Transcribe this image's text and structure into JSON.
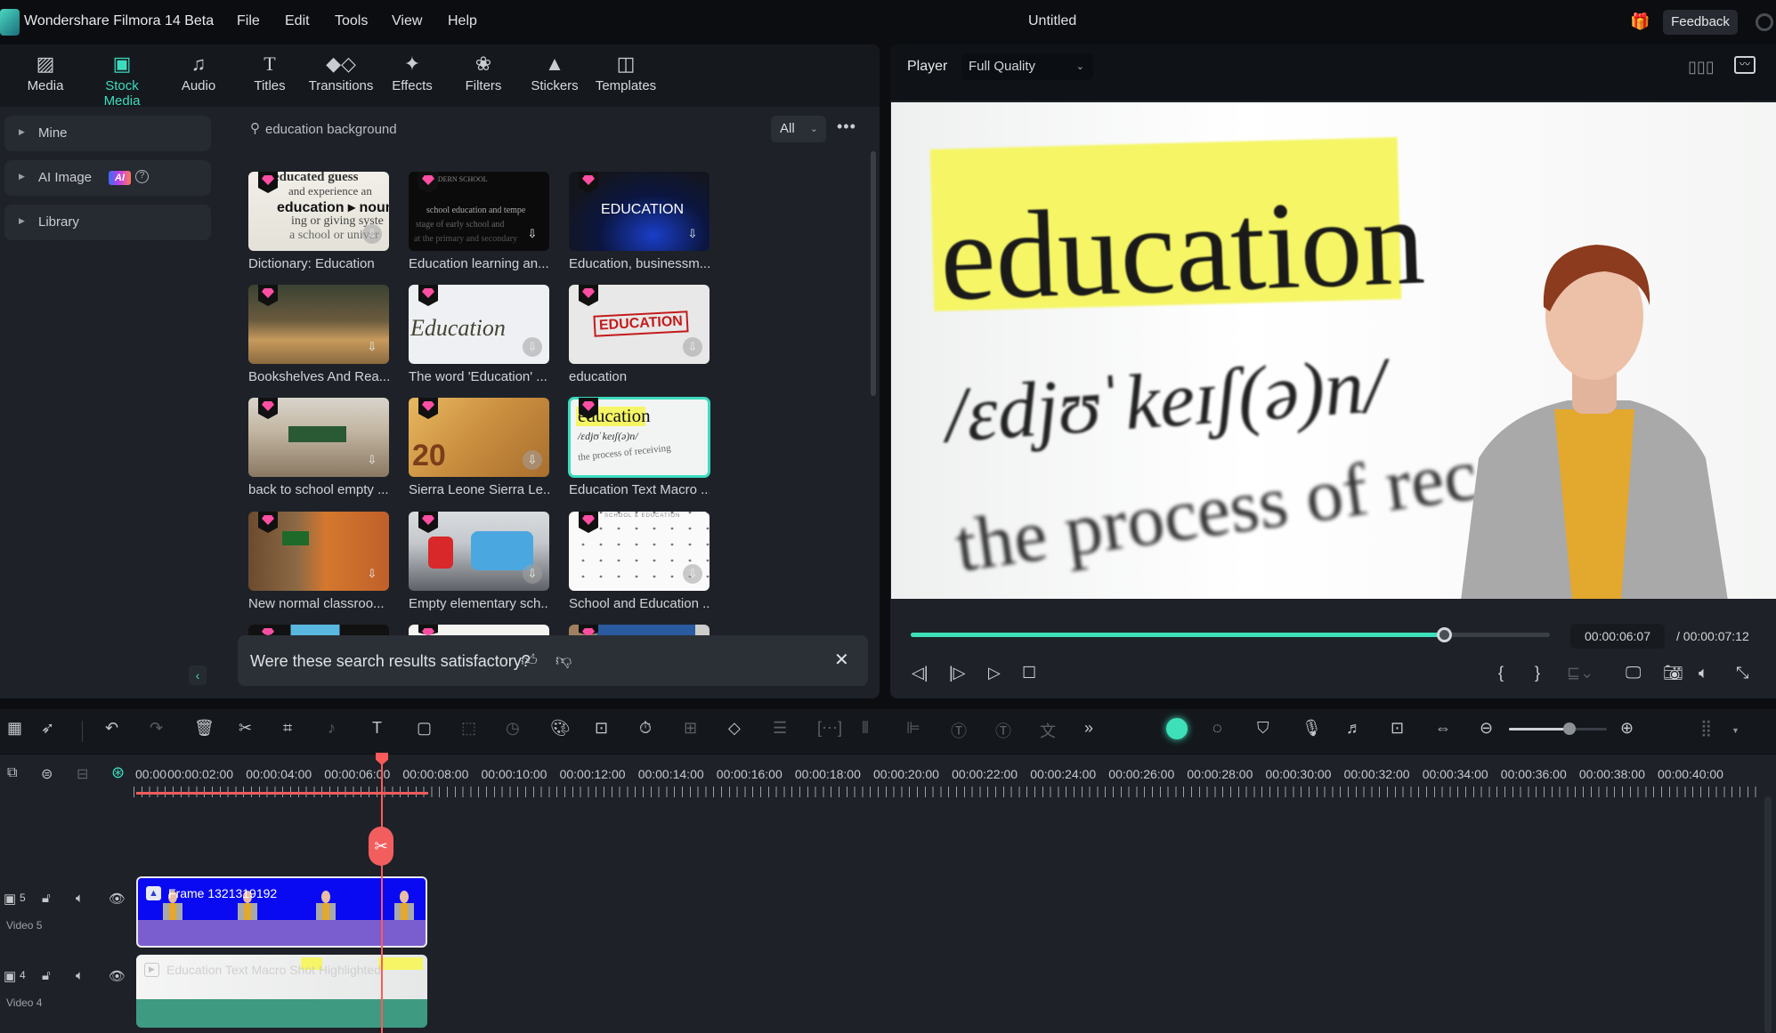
{
  "titlebar": {
    "app_title": "Wondershare Filmora 14 Beta",
    "menu": [
      "File",
      "Edit",
      "Tools",
      "View",
      "Help"
    ],
    "document_title": "Untitled",
    "feedback_label": "Feedback"
  },
  "tabs": [
    {
      "label": "Media",
      "icon": "media-icon",
      "glyph": "🖼"
    },
    {
      "label": "Stock Media",
      "icon": "stock-media-icon",
      "glyph": "▣",
      "active": true
    },
    {
      "label": "Audio",
      "icon": "music-note-icon",
      "glyph": "♫"
    },
    {
      "label": "Titles",
      "icon": "title-t-icon",
      "glyph": "T"
    },
    {
      "label": "Transitions",
      "icon": "transitions-icon",
      "glyph": "◆"
    },
    {
      "label": "Effects",
      "icon": "effects-star-icon",
      "glyph": "✦"
    },
    {
      "label": "Filters",
      "icon": "filters-icon",
      "glyph": "❀"
    },
    {
      "label": "Stickers",
      "icon": "stickers-icon",
      "glyph": "▲"
    },
    {
      "label": "Templates",
      "icon": "templates-icon",
      "glyph": "◫"
    }
  ],
  "sidebar": {
    "items": [
      {
        "label": "Mine"
      },
      {
        "label": "AI Image",
        "badge": "AI"
      },
      {
        "label": "Library"
      }
    ]
  },
  "search": {
    "value": "education background",
    "filter": "All"
  },
  "results": [
    {
      "title": "Dictionary: Education",
      "premium": true
    },
    {
      "title": "Education learning an...",
      "premium": true
    },
    {
      "title": "Education, businessm...",
      "premium": true
    },
    {
      "title": "Bookshelves And Rea...",
      "premium": true
    },
    {
      "title": "The word 'Education' ...",
      "premium": true
    },
    {
      "title": "education",
      "premium": true
    },
    {
      "title": "back to school empty ...",
      "premium": true
    },
    {
      "title": "Sierra Leone Sierra Le...",
      "premium": true
    },
    {
      "title": "Education Text Macro ...",
      "premium": true,
      "selected": true
    },
    {
      "title": "New normal classroo...",
      "premium": true
    },
    {
      "title": "Empty elementary sch...",
      "premium": true
    },
    {
      "title": "School and Education ...",
      "premium": true
    }
  ],
  "thumb_text": {
    "dict1": "educated guess",
    "dict2": "and experience an",
    "dict3": "education ▸ noun",
    "dict4": "ing or giving syste",
    "dict5": "a school or univer",
    "learn1": "MODERN SCHOOL",
    "learn2": "school education and tempe",
    "learn3": "stage of early school and",
    "learn4": "at the primary and secondary",
    "biz": "EDUCATION",
    "word": "Education",
    "stamp": "EDUCATION",
    "macro1": "education",
    "macro2": "/ɛdjʊˈkeɪʃ(ə)n/",
    "macro3": "the process of receiving",
    "sierra": "20",
    "icons_title": "SCHOOL & EDUCATION"
  },
  "feedback_prompt": {
    "text": "Were these search results satisfactory?"
  },
  "player": {
    "label": "Player",
    "quality": "Full Quality",
    "preview_word": "education",
    "preview_phonetic": "/ɛdjʊˈkeɪʃ(ə)n/",
    "preview_definition": "the process of rec",
    "current_time": "00:00:06:07",
    "total_time": "/ 00:00:07:12",
    "progress": 0.836
  },
  "timeline": {
    "ruler_labels": [
      "00:00",
      "00:00:02:00",
      "00:00:04:00",
      "00:00:06:00",
      "00:00:08:00",
      "00:00:10:00",
      "00:00:12:00",
      "00:00:14:00",
      "00:00:16:00",
      "00:00:18:00",
      "00:00:20:00",
      "00:00:22:00",
      "00:00:24:00",
      "00:00:26:00",
      "00:00:28:00",
      "00:00:30:00",
      "00:00:32:00",
      "00:00:34:00",
      "00:00:36:00",
      "00:00:38:00",
      "00:00:40:00"
    ],
    "zoom_level": 0.62,
    "tracks": [
      {
        "number": "5",
        "name": "Video 5",
        "clip": "Frame 1321319192"
      },
      {
        "number": "4",
        "name": "Video 4",
        "clip": "Education Text Macro Shot Highlighted"
      }
    ]
  },
  "colors": {
    "accent": "#3ddbbe",
    "playhead": "#ff5a5a",
    "clip_video5": "#7a5ed0",
    "clip_video4": "#3f9a82"
  }
}
